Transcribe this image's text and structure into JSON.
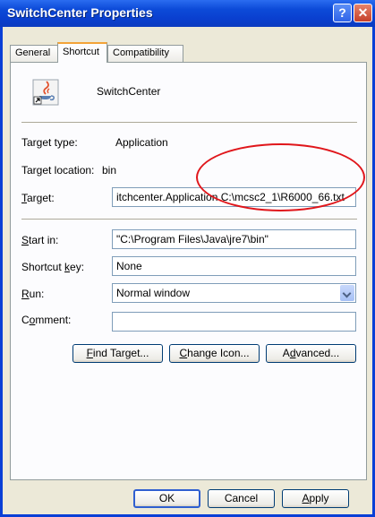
{
  "window": {
    "title": "SwitchCenter Properties"
  },
  "title_buttons": {
    "help": "?",
    "close": "✕"
  },
  "tabs": [
    {
      "label": "General"
    },
    {
      "label": "Shortcut"
    },
    {
      "label": "Compatibility"
    }
  ],
  "shortcut": {
    "app_name": "SwitchCenter",
    "target_type_label": "Target type:",
    "target_type_value": "Application",
    "target_location_label": "Target location:",
    "target_location_value": "bin",
    "target_label_u": "T",
    "target_label_rest": "arget:",
    "target_value": "itchcenter.Application C:\\mcsc2_1\\R6000_66.txt",
    "start_in_label_u": "S",
    "start_in_label_rest": "tart in:",
    "start_in_value": "\"C:\\Program Files\\Java\\jre7\\bin\"",
    "shortcut_key_label_a": "Shortcut ",
    "shortcut_key_label_u": "k",
    "shortcut_key_label_b": "ey:",
    "shortcut_key_value": "None",
    "run_label_u": "R",
    "run_label_rest": "un:",
    "run_value": "Normal window",
    "comment_label_a": "C",
    "comment_label_u": "o",
    "comment_label_b": "mment:",
    "comment_value": ""
  },
  "actions": {
    "find_target_u": "F",
    "find_target_rest": "ind Target...",
    "change_icon_u": "C",
    "change_icon_rest": "hange Icon...",
    "advanced_a": "A",
    "advanced_u": "d",
    "advanced_b": "vanced..."
  },
  "footer": {
    "ok_label": "OK",
    "cancel_label": "Cancel",
    "apply_u": "A",
    "apply_rest": "pply"
  },
  "colors": {
    "titlebar": "#0a3fd6",
    "dialog_bg": "#ece9d8",
    "annotation_circle": "#e0161b"
  }
}
